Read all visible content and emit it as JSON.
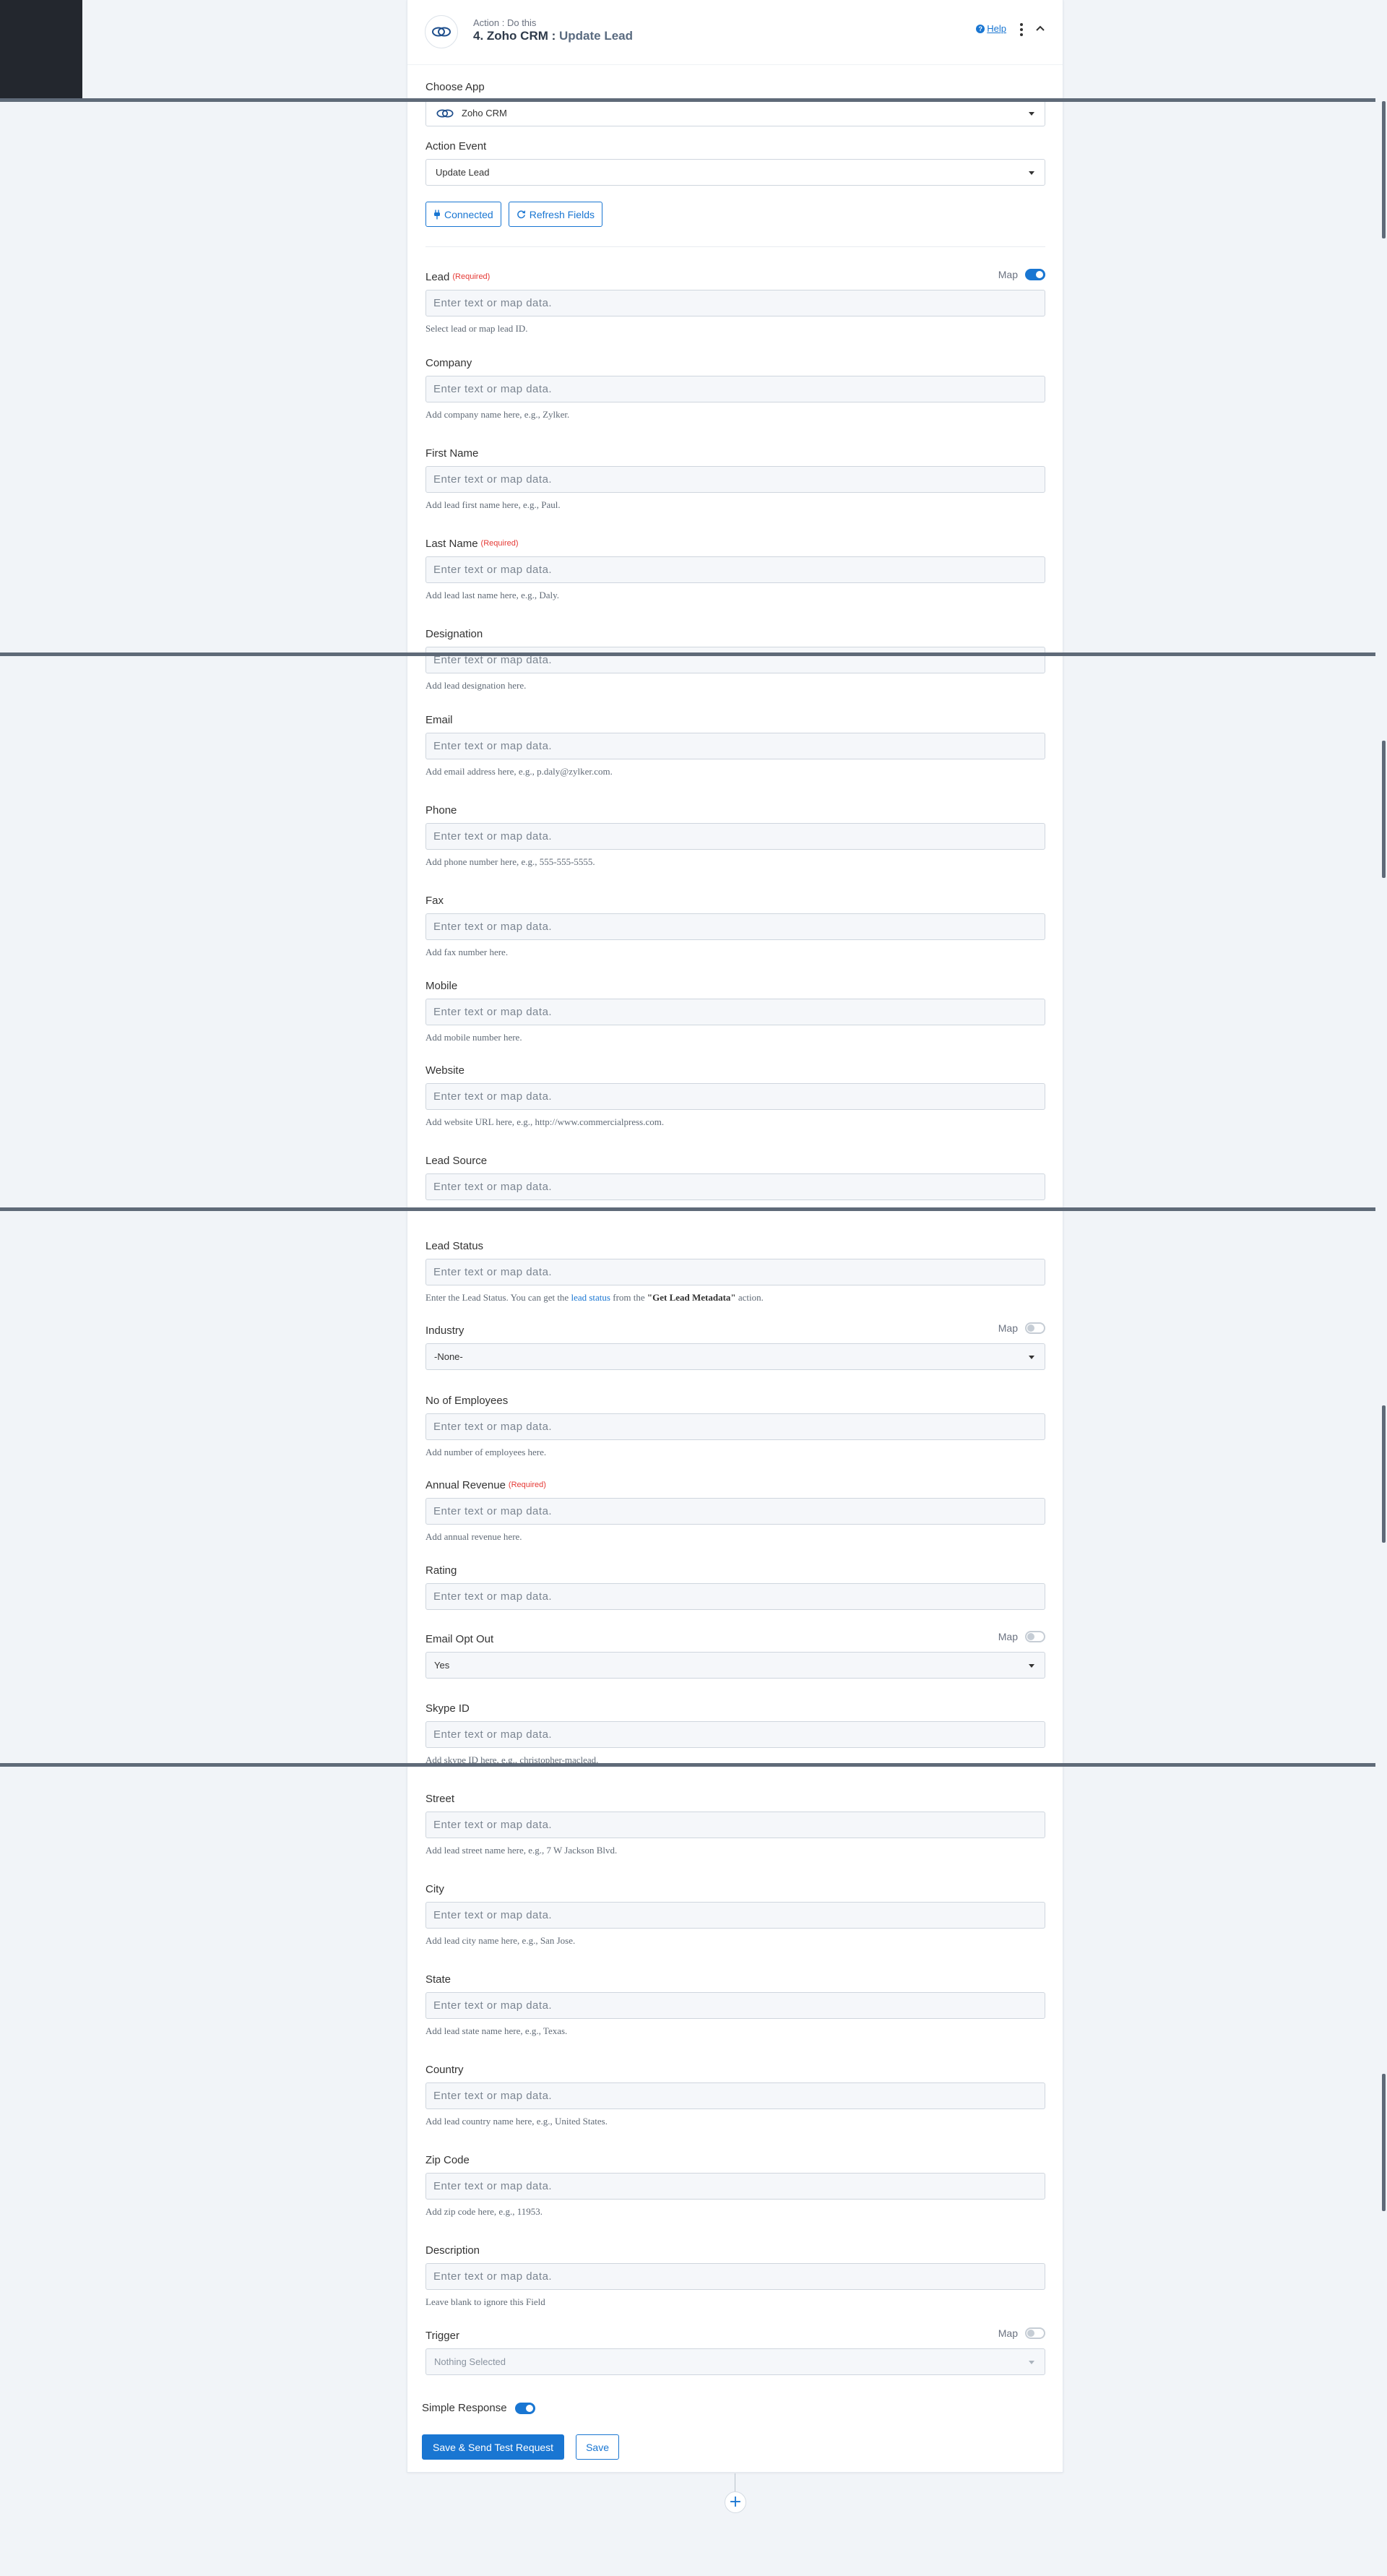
{
  "header": {
    "subtitle": "Action : Do this",
    "title": "4. Zoho CRM : ",
    "event": "Update Lead",
    "help_label": "Help"
  },
  "choose_app": {
    "label": "Choose App",
    "value": "Zoho CRM"
  },
  "action_event": {
    "label": "Action Event",
    "value": "Update Lead"
  },
  "buttons": {
    "connected": "Connected",
    "refresh": "Refresh Fields"
  },
  "common": {
    "placeholder": "Enter text or map data.",
    "required": "(Required)",
    "map": "Map"
  },
  "fields": {
    "lead": {
      "label": "Lead",
      "hint": "Select lead or map lead ID."
    },
    "company": {
      "label": "Company",
      "hint": "Add company name here, e.g., Zylker."
    },
    "first_name": {
      "label": "First Name",
      "hint": "Add lead first name here, e.g., Paul."
    },
    "last_name": {
      "label": "Last Name",
      "hint": "Add lead last name here, e.g., Daly."
    },
    "designation": {
      "label": "Designation",
      "hint": "Add lead designation here."
    },
    "email": {
      "label": "Email",
      "hint": "Add email address here, e.g., p.daly@zylker.com."
    },
    "phone": {
      "label": "Phone",
      "hint": "Add phone number here, e.g., 555-555-5555."
    },
    "fax": {
      "label": "Fax",
      "hint": "Add fax number here."
    },
    "mobile": {
      "label": "Mobile",
      "hint": "Add mobile number here."
    },
    "website": {
      "label": "Website",
      "hint": "Add website URL here, e.g., http://www.commercialpress.com."
    },
    "lead_source": {
      "label": "Lead Source"
    },
    "lead_status": {
      "label": "Lead Status",
      "hint_pre": "Enter the Lead Status. You can get the ",
      "hint_link": "lead status",
      "hint_mid": " from the ",
      "hint_bold": "\"Get Lead Metadata\"",
      "hint_post": " action."
    },
    "industry": {
      "label": "Industry",
      "value": "-None-"
    },
    "employees": {
      "label": "No of Employees",
      "hint": "Add number of employees here."
    },
    "revenue": {
      "label": "Annual Revenue",
      "hint": "Add annual revenue here."
    },
    "rating": {
      "label": "Rating"
    },
    "email_opt_out": {
      "label": "Email Opt Out",
      "value": "Yes"
    },
    "skype": {
      "label": "Skype ID",
      "hint": "Add skype ID here, e.g., christopher-maclead."
    },
    "street": {
      "label": "Street",
      "hint": "Add lead street name here, e.g., 7 W Jackson Blvd."
    },
    "city": {
      "label": "City",
      "hint": "Add lead city name here, e.g., San Jose."
    },
    "state": {
      "label": "State",
      "hint": "Add lead state name here, e.g., Texas."
    },
    "country": {
      "label": "Country",
      "hint": "Add lead country name here, e.g., United States."
    },
    "zip": {
      "label": "Zip Code",
      "hint": "Add zip code here, e.g., 11953."
    },
    "description": {
      "label": "Description",
      "hint": "Leave blank to ignore this Field"
    },
    "trigger": {
      "label": "Trigger",
      "value": "Nothing Selected"
    }
  },
  "footer": {
    "simple_response": "Simple Response",
    "save_send": "Save & Send Test Request",
    "save": "Save"
  },
  "colors": {
    "accent": "#1976d2",
    "required": "#e53935"
  },
  "icons": [
    "zoho-crm-icon",
    "help-icon",
    "kebab-menu-icon",
    "chevron-up-icon",
    "caret-down-icon",
    "plug-icon",
    "refresh-icon",
    "plus-icon"
  ]
}
